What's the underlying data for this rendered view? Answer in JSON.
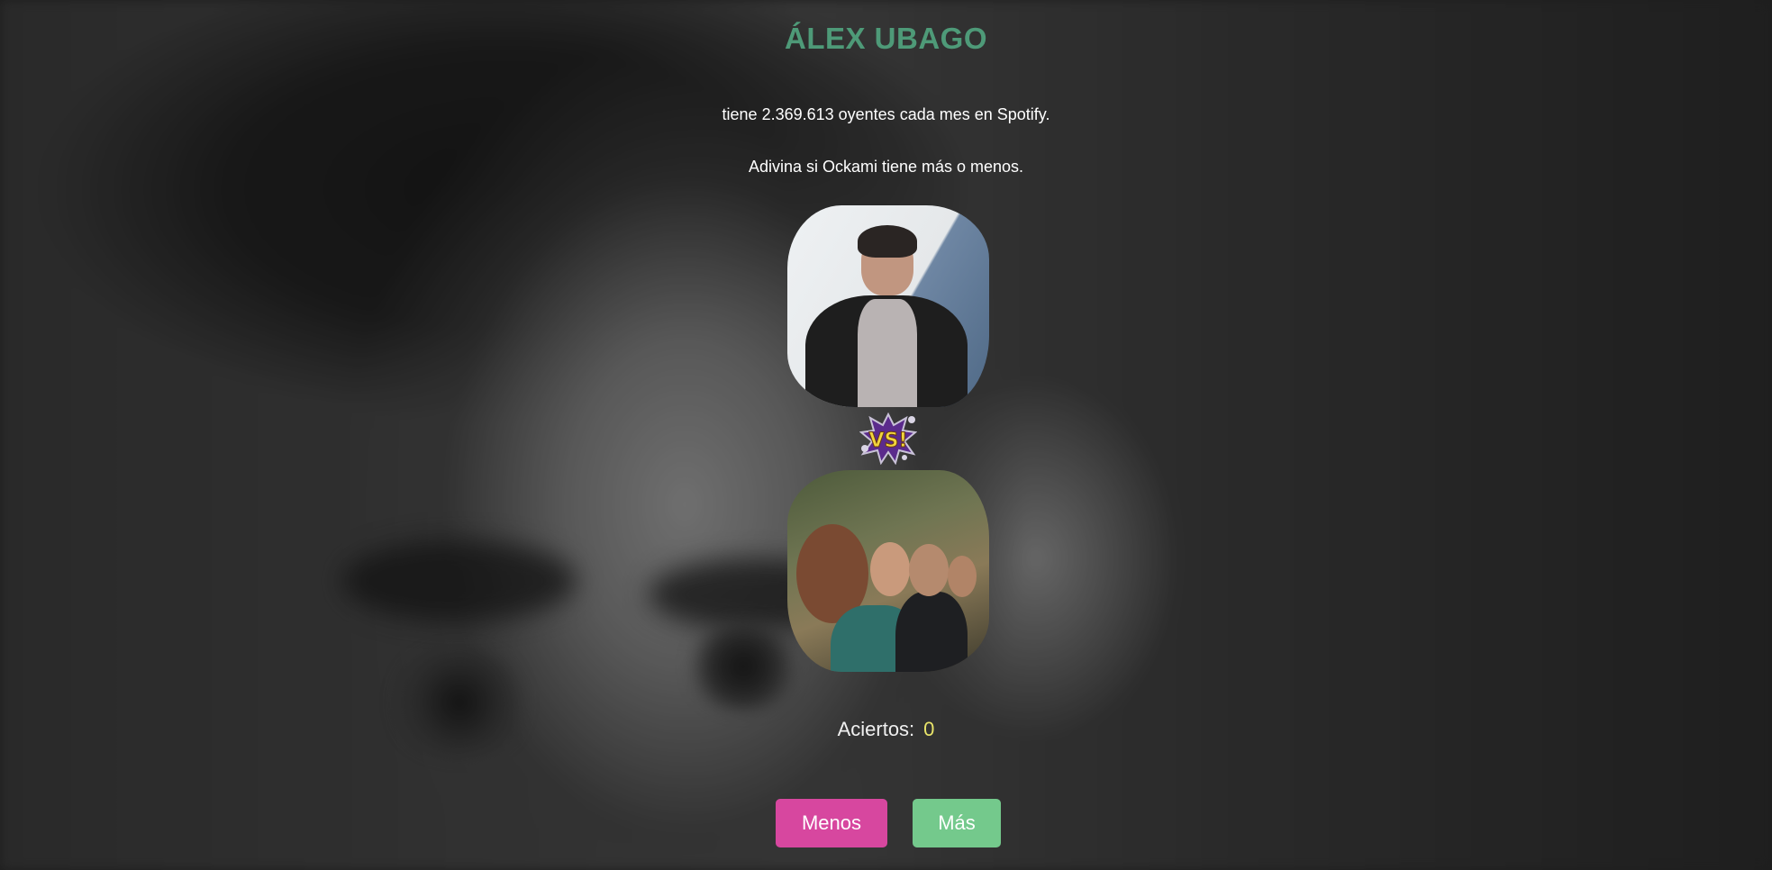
{
  "game": {
    "artist_name": "ÁLEX UBAGO",
    "listeners_text": "tiene 2.369.613 oyentes cada mes en Spotify.",
    "prompt_text": "Adivina si Ockami tiene más o menos.",
    "vs_label": "VS!",
    "score_label": "Aciertos:",
    "score_value": "0",
    "less_button": "Menos",
    "more_button": "Más"
  },
  "colors": {
    "title": "#4e9a78",
    "score_value": "#e9e56a",
    "less_button": "#d7479f",
    "more_button": "#74c98c",
    "vs_text": "#f2d53c",
    "vs_burst": "#5b2b8c"
  }
}
